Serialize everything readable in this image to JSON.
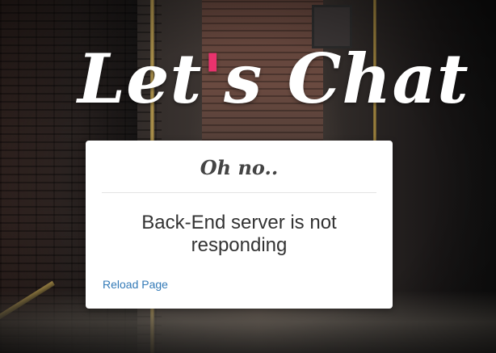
{
  "logo": {
    "part1": "Let",
    "apostrophe": "'",
    "part2": "s Chat"
  },
  "error_card": {
    "title": "Oh no..",
    "message": "Back-End server is not responding",
    "reload_link": "Reload Page"
  },
  "colors": {
    "logo_text": "#ffffff",
    "logo_accent": "#e8336d",
    "link": "#337ab7",
    "card_bg": "#ffffff"
  }
}
